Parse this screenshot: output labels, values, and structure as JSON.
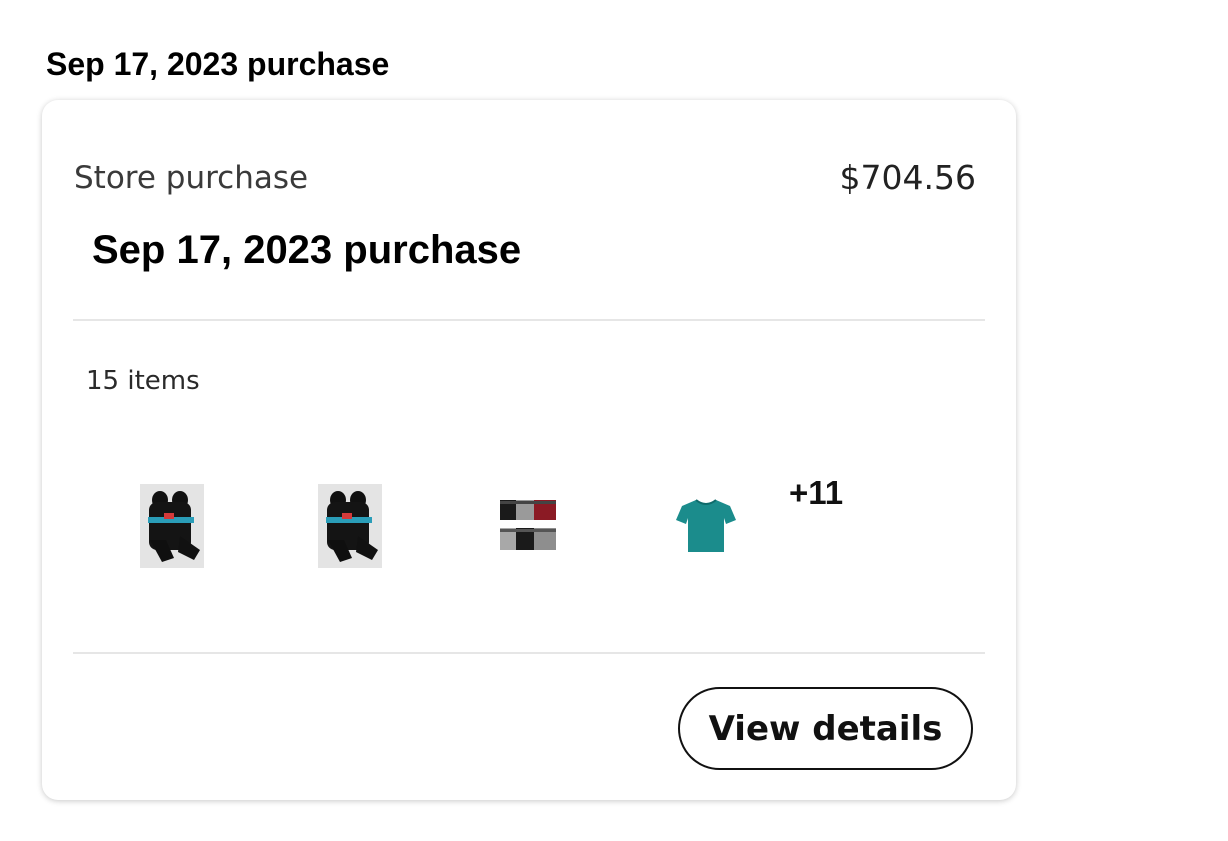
{
  "page": {
    "heading": "Sep 17, 2023 purchase"
  },
  "order_card": {
    "type_label": "Store purchase",
    "total": "$704.56",
    "title": "Sep 17, 2023 purchase",
    "item_count": "15 items",
    "thumbnails": [
      {
        "icon": "socks-pack-icon",
        "description": "black socks pack"
      },
      {
        "icon": "socks-pack-icon",
        "description": "black socks pack"
      },
      {
        "icon": "boxer-briefs-icon",
        "description": "boxer briefs multipack"
      },
      {
        "icon": "tshirt-icon",
        "description": "teal t-shirt"
      }
    ],
    "more_count": "+11",
    "view_details_label": "View details"
  },
  "colors": {
    "tshirt": "#1b8c8c",
    "socks": "#111111",
    "socks_band": "#2a9db8",
    "boxer_red": "#8b1a24",
    "boxer_gray": "#9a9a9a",
    "card_border": "#e6e6e6"
  }
}
